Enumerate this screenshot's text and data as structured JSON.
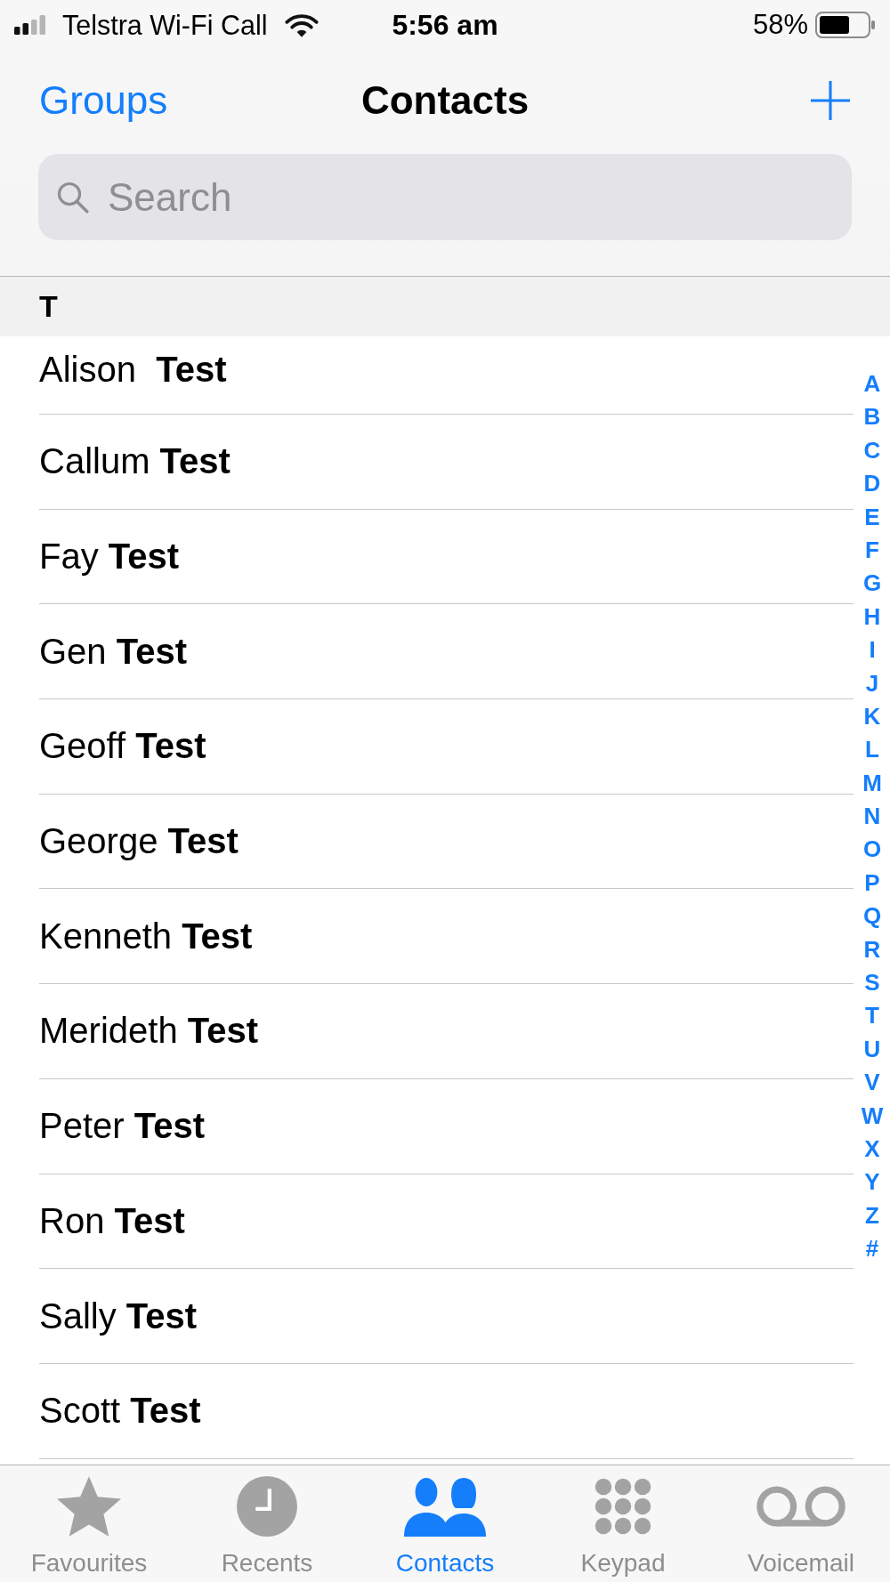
{
  "status_bar": {
    "carrier": "Telstra Wi-Fi Call",
    "time": "5:56 am",
    "battery_percent": "58%"
  },
  "nav": {
    "left_button": "Groups",
    "title": "Contacts"
  },
  "search": {
    "placeholder": "Search"
  },
  "section": {
    "header": "T",
    "contacts": [
      {
        "name": "Alison  **Test**"
      },
      {
        "name": "Callum **Test**"
      },
      {
        "name": "Fay **Test**"
      },
      {
        "name": "Gen **Test**"
      },
      {
        "name": "Geoff **Test**"
      },
      {
        "name": "George **Test**"
      },
      {
        "name": "Kenneth **Test**"
      },
      {
        "name": "Merideth **Test**"
      },
      {
        "name": "Peter **Test**"
      },
      {
        "name": "Ron **Test**"
      },
      {
        "name": "Sally **Test**"
      },
      {
        "name": "Scott **Test**"
      }
    ]
  },
  "index": [
    "A",
    "B",
    "C",
    "D",
    "E",
    "F",
    "G",
    "H",
    "I",
    "J",
    "K",
    "L",
    "M",
    "N",
    "O",
    "P",
    "Q",
    "R",
    "S",
    "T",
    "U",
    "V",
    "W",
    "X",
    "Y",
    "Z",
    "#"
  ],
  "tab_bar": [
    {
      "label": "Favourites",
      "kind": "star",
      "selected": false
    },
    {
      "label": "Recents",
      "kind": "clock",
      "selected": false
    },
    {
      "label": "Contacts",
      "kind": "people",
      "selected": true
    },
    {
      "label": "Keypad",
      "kind": "keypad",
      "selected": false
    },
    {
      "label": "Voicemail",
      "kind": "voicemail",
      "selected": false
    }
  ]
}
